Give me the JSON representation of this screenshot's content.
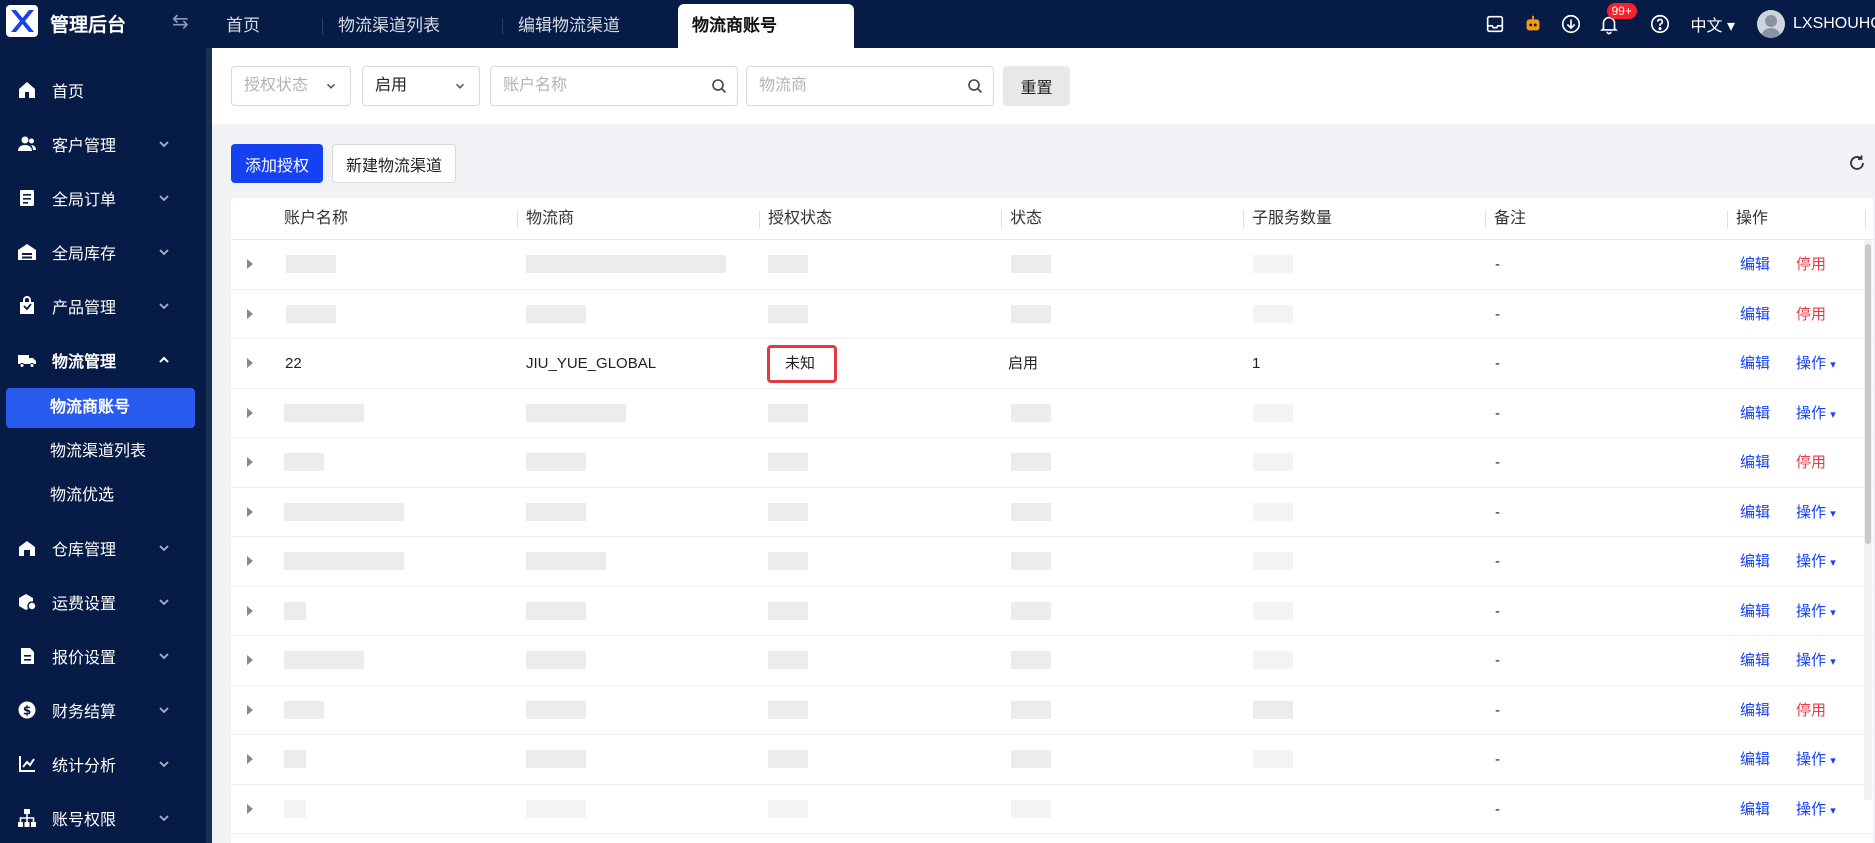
{
  "app": {
    "title": "管理后台",
    "logo_icon": "x-logo-icon"
  },
  "topbar": {
    "tabs": [
      {
        "label": "首页",
        "active": false
      },
      {
        "label": "物流渠道列表",
        "active": false
      },
      {
        "label": "编辑物流渠道",
        "active": false
      },
      {
        "label": "物流商账号",
        "active": true
      }
    ],
    "notification_badge": "99+",
    "language": "中文",
    "username": "LXSHOUHOU"
  },
  "sidebar": {
    "items": [
      {
        "label": "首页",
        "icon": "home-icon"
      },
      {
        "label": "客户管理",
        "icon": "users-icon"
      },
      {
        "label": "全局订单",
        "icon": "order-icon"
      },
      {
        "label": "全局库存",
        "icon": "warehouse-icon"
      },
      {
        "label": "产品管理",
        "icon": "product-icon"
      },
      {
        "label": "物流管理",
        "icon": "truck-icon",
        "expanded": true
      },
      {
        "label": "仓库管理",
        "icon": "store-icon"
      },
      {
        "label": "运费设置",
        "icon": "shipping-icon"
      },
      {
        "label": "报价设置",
        "icon": "quote-icon"
      },
      {
        "label": "财务结算",
        "icon": "dollar-icon"
      },
      {
        "label": "统计分析",
        "icon": "chart-icon"
      },
      {
        "label": "账号权限",
        "icon": "org-icon"
      }
    ],
    "sub_items": [
      {
        "label": "物流商账号",
        "active": true
      },
      {
        "label": "物流渠道列表",
        "active": false
      },
      {
        "label": "物流优选",
        "active": false
      }
    ]
  },
  "filters": {
    "auth_status_placeholder": "授权状态",
    "status_value": "启用",
    "account_name_placeholder": "账户名称",
    "carrier_placeholder": "物流商",
    "reset_label": "重置"
  },
  "actions": {
    "add_auth_label": "添加授权",
    "new_channel_label": "新建物流渠道"
  },
  "table": {
    "columns": [
      "账户名称",
      "物流商",
      "授权状态",
      "状态",
      "子服务数量",
      "备注",
      "操作"
    ],
    "highlight_row": {
      "account_name": "22",
      "carrier": "JIU_YUE_GLOBAL",
      "auth_status": "未知",
      "status": "启用",
      "sub_service_count": "1"
    },
    "rows": [
      {
        "remark": "-",
        "edit": "编辑",
        "action": "停用",
        "action_type": "danger"
      },
      {
        "remark": "-",
        "edit": "编辑",
        "action": "停用",
        "action_type": "danger"
      },
      {
        "remark": "-",
        "edit": "编辑",
        "action": "操作",
        "action_type": "menu"
      },
      {
        "remark": "-",
        "edit": "编辑",
        "action": "操作",
        "action_type": "menu"
      },
      {
        "remark": "-",
        "edit": "编辑",
        "action": "停用",
        "action_type": "danger"
      },
      {
        "remark": "-",
        "edit": "编辑",
        "action": "操作",
        "action_type": "menu"
      },
      {
        "remark": "-",
        "edit": "编辑",
        "action": "操作",
        "action_type": "menu"
      },
      {
        "remark": "-",
        "edit": "编辑",
        "action": "操作",
        "action_type": "menu"
      },
      {
        "remark": "-",
        "edit": "编辑",
        "action": "操作",
        "action_type": "menu"
      },
      {
        "remark": "-",
        "edit": "编辑",
        "action": "停用",
        "action_type": "danger"
      },
      {
        "remark": "-",
        "edit": "编辑",
        "action": "操作",
        "action_type": "menu"
      },
      {
        "remark": "-",
        "edit": "编辑",
        "action": "操作",
        "action_type": "menu"
      }
    ]
  },
  "colors": {
    "nav_bg": "#061b45",
    "primary": "#1541f2",
    "danger": "#e83a44",
    "highlight": "#e53940"
  }
}
